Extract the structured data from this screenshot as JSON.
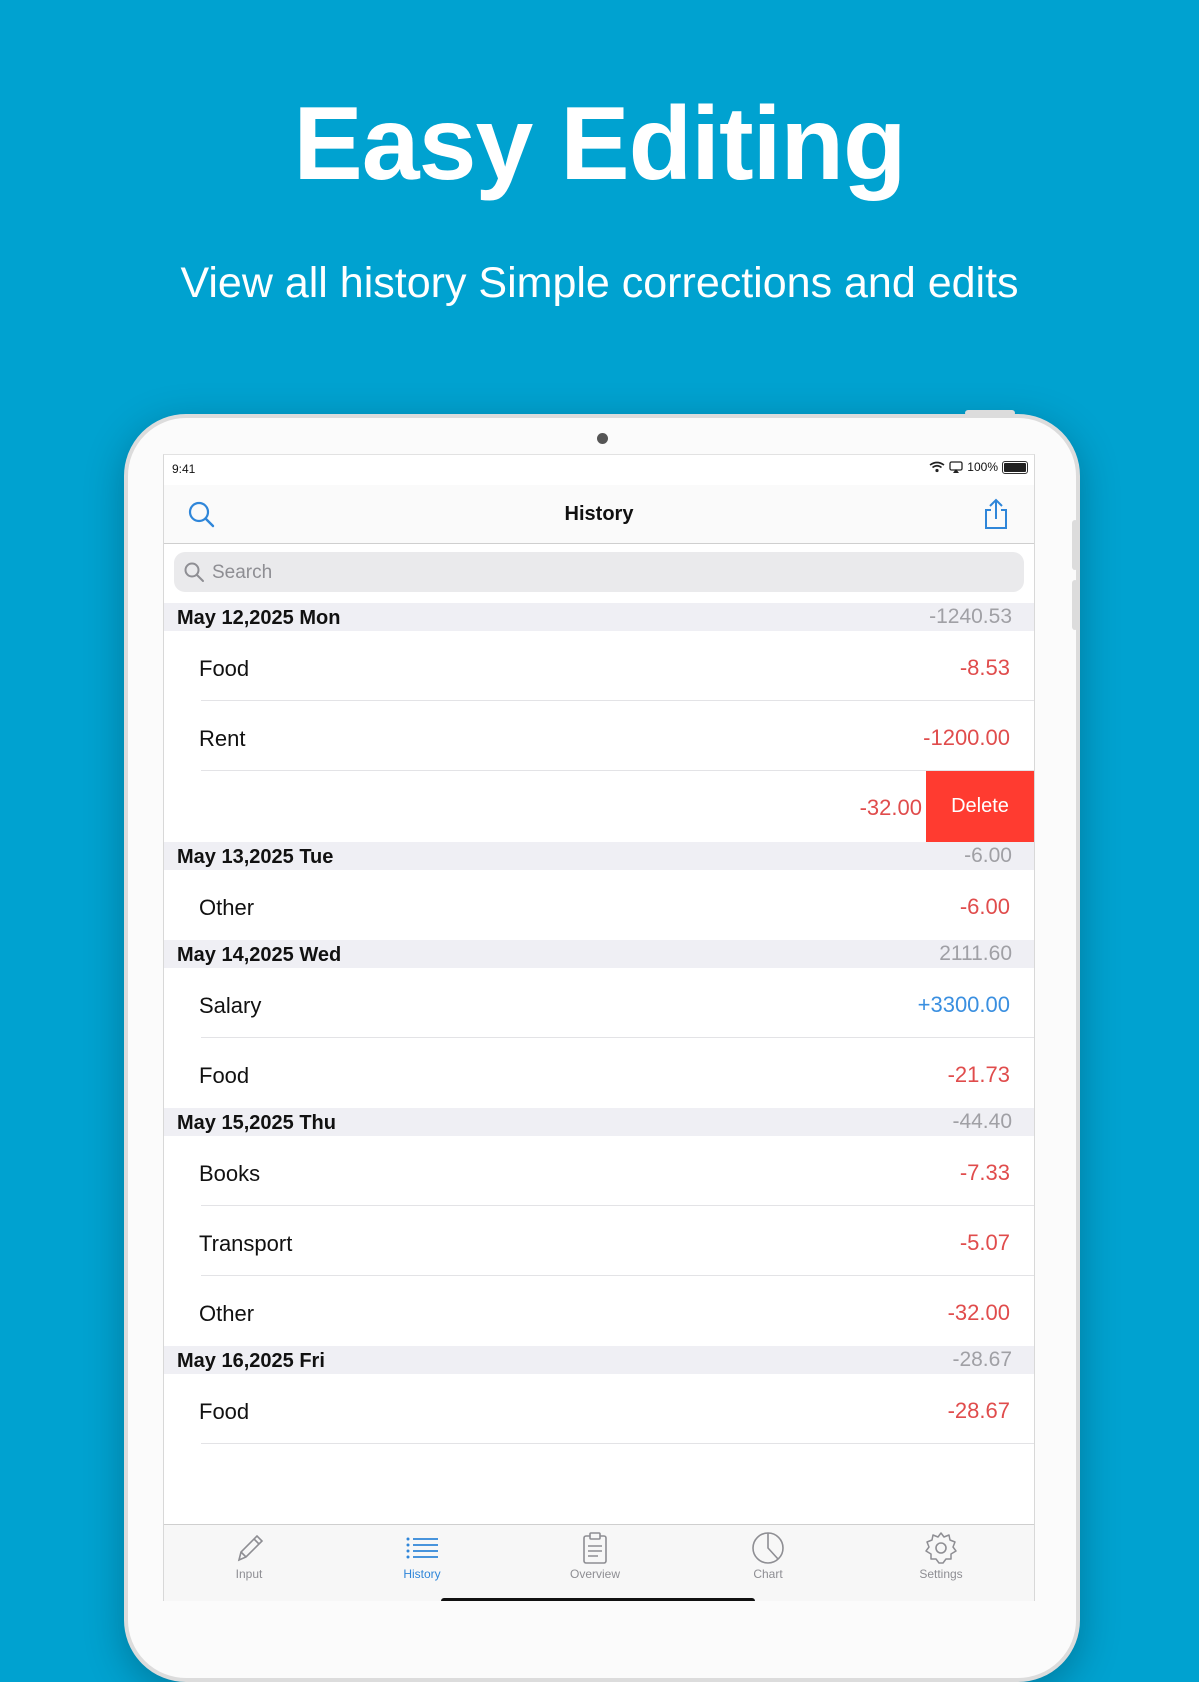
{
  "promo": {
    "title": "Easy Editing",
    "subtitle": "View all history Simple corrections and edits"
  },
  "status_bar": {
    "time": "9:41",
    "battery": "100%"
  },
  "nav": {
    "title": "History"
  },
  "search": {
    "placeholder": "Search"
  },
  "sections": [
    {
      "date": "May 12,2025 Mon",
      "total": "-1240.53",
      "rows": [
        {
          "category": "Food",
          "amount": "-8.53"
        },
        {
          "category": "Rent",
          "amount": "-1200.00"
        },
        {
          "category": "",
          "amount": "-32.00",
          "delete_label": "Delete"
        }
      ]
    },
    {
      "date": "May 13,2025 Tue",
      "total": "-6.00",
      "rows": [
        {
          "category": "Other",
          "amount": "-6.00"
        }
      ]
    },
    {
      "date": "May 14,2025 Wed",
      "total": "2111.60",
      "rows": [
        {
          "category": "Salary",
          "amount": "+3300.00"
        },
        {
          "category": "Food",
          "amount": "-21.73"
        }
      ]
    },
    {
      "date": "May 15,2025 Thu",
      "total": "-44.40",
      "rows": [
        {
          "category": "Books",
          "amount": "-7.33"
        },
        {
          "category": "Transport",
          "amount": "-5.07"
        },
        {
          "category": "Other",
          "amount": "-32.00"
        }
      ]
    },
    {
      "date": "May 16,2025 Fri",
      "total": "-28.67",
      "rows": [
        {
          "category": "Food",
          "amount": "-28.67"
        }
      ]
    }
  ],
  "tabs": [
    {
      "label": "Input",
      "icon": "pencil-icon"
    },
    {
      "label": "History",
      "icon": "list-icon",
      "active": true
    },
    {
      "label": "Overview",
      "icon": "clipboard-icon"
    },
    {
      "label": "Chart",
      "icon": "pie-chart-icon"
    },
    {
      "label": "Settings",
      "icon": "gear-icon"
    }
  ],
  "colors": {
    "background": "#00A2D0",
    "expense": "#E04C4C",
    "income": "#3A8FE0",
    "delete": "#FF3B30",
    "active_tab": "#2F86D9"
  }
}
